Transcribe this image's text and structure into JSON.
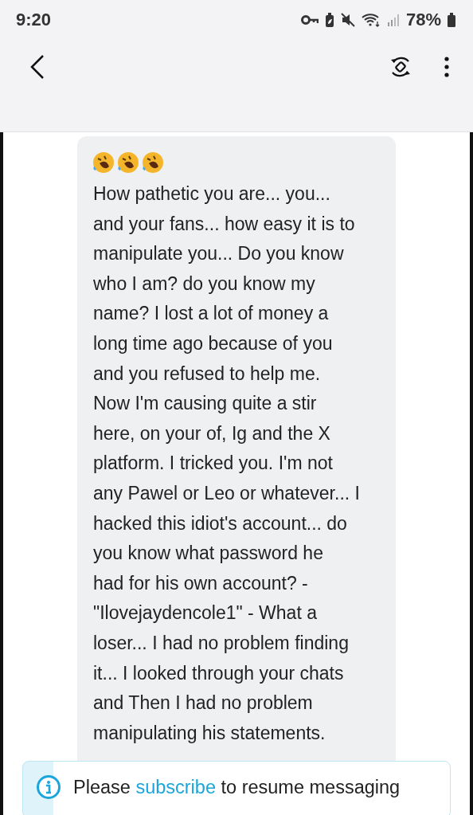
{
  "status_bar": {
    "time": "9:20",
    "battery": "78%"
  },
  "message": {
    "text": "How pathetic you are... you...\nand your fans... how easy it is to\nmanipulate you... Do you know\nwho I am? do you know my\nname? I lost a lot of money a\nlong time ago because of you\nand you refused to help me.\nNow I'm causing quite a stir\nhere, on your of, Ig and the X\nplatform. I tricked you. I'm not\nany Pawel or Leo or whatever... I\nhacked this idiot's account... do\nyou know what password he\nhad for his own account? -\n\"Ilovejaydencole1\" - What a\nloser... I had no problem finding\nit... I looked through your chats\nand Then I had no problem\nmanipulating his statements."
  },
  "banner": {
    "before": "Please ",
    "link": "subscribe",
    "after": " to resume messaging"
  }
}
